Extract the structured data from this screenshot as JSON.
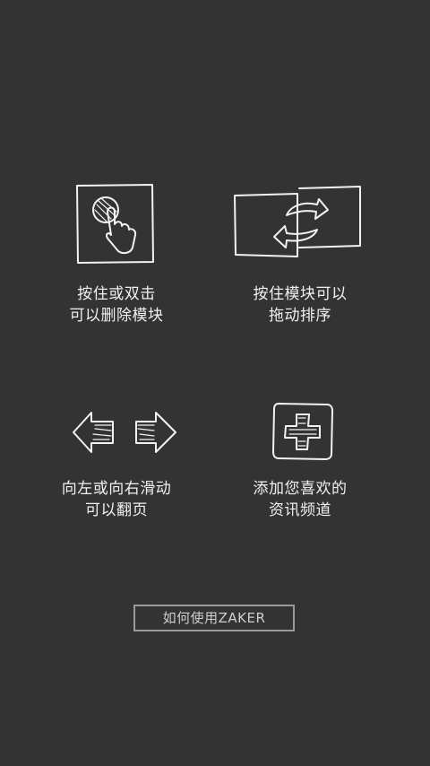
{
  "tips": [
    {
      "icon": "tap-hand-icon",
      "lines": [
        "按住或双击",
        "可以删除模块"
      ]
    },
    {
      "icon": "swap-cards-icon",
      "lines": [
        "按住模块可以",
        "拖动排序"
      ]
    },
    {
      "icon": "left-right-arrows-icon",
      "lines": [
        "向左或向右滑动",
        "可以翻页"
      ]
    },
    {
      "icon": "add-plus-icon",
      "lines": [
        "添加您喜欢的",
        "资讯频道"
      ]
    }
  ],
  "howto_button": {
    "label": "如何使用ZAKER"
  },
  "colors": {
    "background": "#333333",
    "stroke": "#f2f2f2",
    "button_border": "#9a9a9a"
  }
}
